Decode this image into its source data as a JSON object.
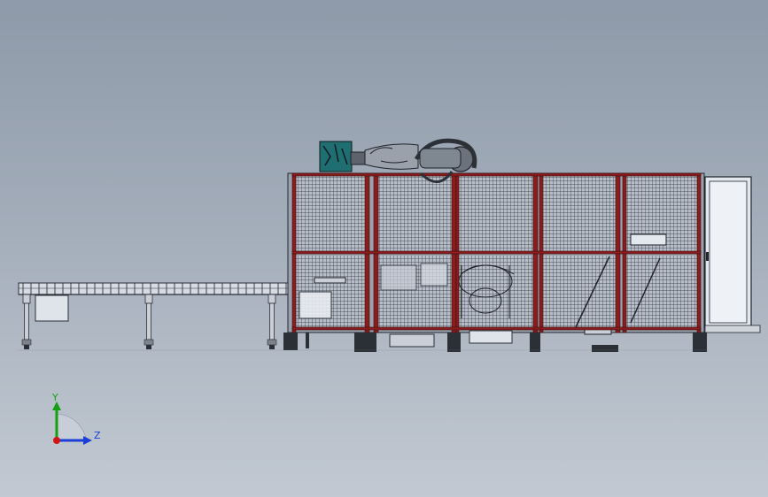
{
  "viewport": {
    "background_top": "#8e9aa9",
    "background_bottom": "#c2c9d2"
  },
  "model": {
    "frame_color": "#8a1d1d",
    "mesh_color": "#2a2f38",
    "cabinet_color": "#e3e7ee",
    "conveyor_color": "#d6dbe4"
  },
  "triad": {
    "y_label": "Y",
    "z_label": "Z",
    "y_color": "#14a014",
    "z_color": "#1b3fd6",
    "x_color": "#d01515"
  }
}
